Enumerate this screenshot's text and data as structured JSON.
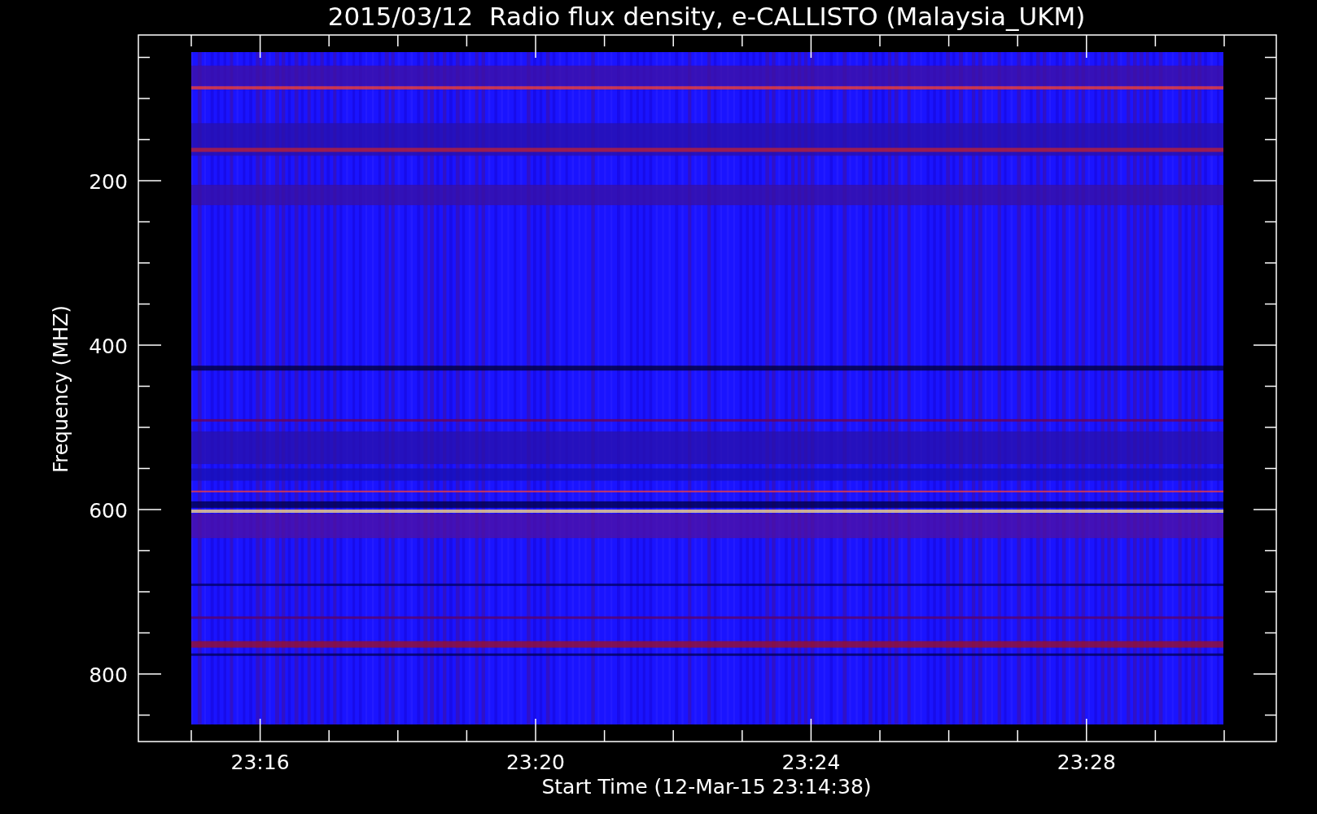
{
  "title": "2015/03/12  Radio flux density, e-CALLISTO (Malaysia_UKM)",
  "y_axis": {
    "label": "Frequency (MHZ)",
    "ticks": [
      "200",
      "400",
      "600",
      "800"
    ]
  },
  "x_axis": {
    "label": "Start Time (12-Mar-15 23:14:38)",
    "ticks": [
      "23:16",
      "23:20",
      "23:24",
      "23:28"
    ]
  }
}
